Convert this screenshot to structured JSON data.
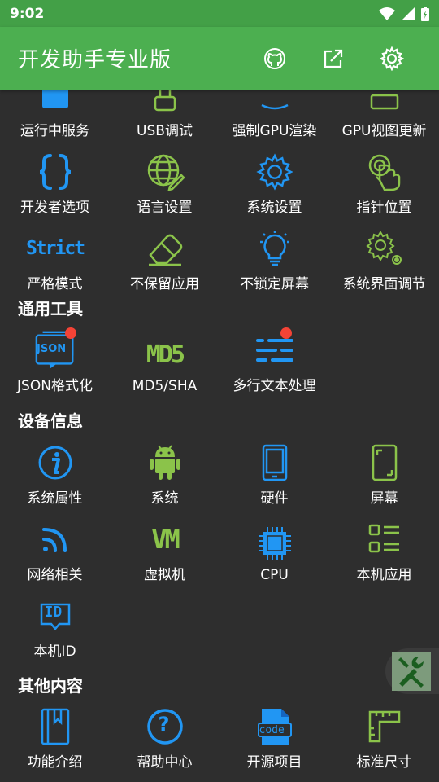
{
  "status": {
    "time": "9:02"
  },
  "appbar": {
    "title": "开发助手专业版"
  },
  "colors": {
    "green": "#4caf50",
    "blue": "#2196f3",
    "lime": "#8bc34a",
    "badge": "#f44336",
    "bg": "#2e2e2e"
  },
  "dev_tools": [
    {
      "label": "运行中服务",
      "icon": "running-services-icon"
    },
    {
      "label": "USB调试",
      "icon": "usb-icon"
    },
    {
      "label": "强制GPU渲染",
      "icon": "gpu-icon"
    },
    {
      "label": "GPU视图更新",
      "icon": "gpu-view-icon"
    },
    {
      "label": "开发者选项",
      "icon": "braces-icon"
    },
    {
      "label": "语言设置",
      "icon": "globe-edit-icon"
    },
    {
      "label": "系统设置",
      "icon": "gear-icon"
    },
    {
      "label": "指针位置",
      "icon": "pointer-touch-icon"
    },
    {
      "label": "严格模式",
      "icon": "strict-icon",
      "icon_text": "Strict"
    },
    {
      "label": "不保留应用",
      "icon": "eraser-icon"
    },
    {
      "label": "不锁定屏幕",
      "icon": "lightbulb-icon"
    },
    {
      "label": "系统界面调节",
      "icon": "gears-icon"
    }
  ],
  "sections": {
    "common": "通用工具",
    "device": "设备信息",
    "other": "其他内容"
  },
  "common_tools": [
    {
      "label": "JSON格式化",
      "icon": "json-icon",
      "icon_text": "JSON",
      "badge": true
    },
    {
      "label": "MD5/SHA",
      "icon": "md5-icon",
      "icon_text": "MD5"
    },
    {
      "label": "多行文本处理",
      "icon": "text-lines-icon",
      "badge": true
    }
  ],
  "device_info": [
    {
      "label": "系统属性",
      "icon": "info-icon"
    },
    {
      "label": "系统",
      "icon": "android-icon"
    },
    {
      "label": "硬件",
      "icon": "phone-icon"
    },
    {
      "label": "屏幕",
      "icon": "screen-icon"
    },
    {
      "label": "网络相关",
      "icon": "rss-icon"
    },
    {
      "label": "虚拟机",
      "icon": "vm-icon",
      "icon_text": "VM"
    },
    {
      "label": "CPU",
      "icon": "cpu-icon"
    },
    {
      "label": "本机应用",
      "icon": "apps-list-icon"
    },
    {
      "label": "本机ID",
      "icon": "id-icon",
      "icon_text": "ID"
    }
  ],
  "other": [
    {
      "label": "功能介绍",
      "icon": "book-icon"
    },
    {
      "label": "帮助中心",
      "icon": "help-icon",
      "icon_text": "?"
    },
    {
      "label": "开源项目",
      "icon": "code-file-icon",
      "icon_text": "code"
    },
    {
      "label": "标准尺寸",
      "icon": "ruler-icon"
    }
  ]
}
